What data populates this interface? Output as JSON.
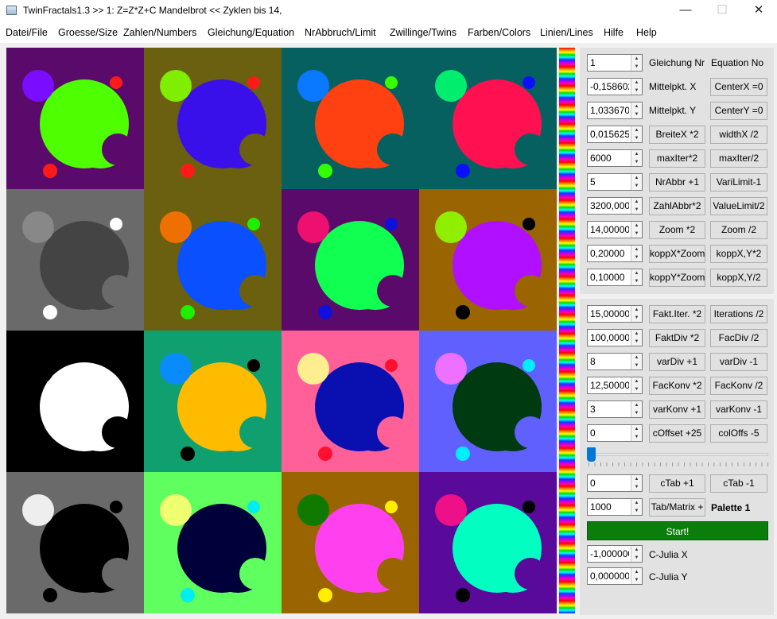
{
  "window": {
    "title": "TwinFractals1.3 >> 1: Z=Z*Z+C Mandelbrot << Zyklen bis 14,",
    "minimize": "—",
    "maximize": "☐",
    "close": "✕"
  },
  "menu": [
    "Datei/File",
    "Groesse/Size",
    "Zahlen/Numbers",
    "Gleichung/Equation",
    "NrAbbruch/Limit",
    "Zwillinge/Twins",
    "Farben/Colors",
    "Linien/Lines",
    "Hilfe",
    "Help"
  ],
  "fractal_tiles": [
    {
      "bg": "#5a0a6a",
      "body": "#4dff00",
      "big_bud": "#7a0dff",
      "small_bud": "#ff1a1a",
      "bottom_bud": "#ff1a1a"
    },
    {
      "bg": "#6b6010",
      "body": "#3a10ea",
      "big_bud": "#80ee00",
      "small_bud": "#ff1a1a",
      "bottom_bud": "#ff1a1a"
    },
    {
      "bg": "#076060",
      "body": "#ff4010",
      "big_bud": "#0a78ff",
      "small_bud": "#33ff00",
      "bottom_bud": "#33ff00"
    },
    {
      "bg": "#076060",
      "body": "#ff1050",
      "big_bud": "#00ee70",
      "small_bud": "#0a10ff",
      "bottom_bud": "#0a10ff"
    },
    {
      "bg": "#6a6a6a",
      "body": "#444444",
      "big_bud": "#888888",
      "small_bud": "#ffffff",
      "bottom_bud": "#ffffff"
    },
    {
      "bg": "#6b6010",
      "body": "#0a50ff",
      "big_bud": "#ee7000",
      "small_bud": "#20ee00",
      "bottom_bud": "#20ee00"
    },
    {
      "bg": "#5a0a6a",
      "body": "#10ff50",
      "big_bud": "#ee1070",
      "small_bud": "#1010dd",
      "bottom_bud": "#1010dd"
    },
    {
      "bg": "#9a6400",
      "body": "#b010ff",
      "big_bud": "#90ee00",
      "small_bud": "#000000",
      "bottom_bud": "#000000"
    },
    {
      "bg": "#000000",
      "body": "#ffffff",
      "big_bud": "#000000",
      "small_bud": "#000000",
      "bottom_bud": "#000000"
    },
    {
      "bg": "#10a070",
      "body": "#ffbb00",
      "big_bud": "#0a8aff",
      "small_bud": "#000000",
      "bottom_bud": "#000000"
    },
    {
      "bg": "#ff6098",
      "body": "#0a10b0",
      "big_bud": "#ffee90",
      "small_bud": "#ff1030",
      "bottom_bud": "#ff1030"
    },
    {
      "bg": "#6060ff",
      "body": "#003a10",
      "big_bud": "#ee70ff",
      "small_bud": "#00eeff",
      "bottom_bud": "#00eeff"
    },
    {
      "bg": "#6a6a6a",
      "body": "#000000",
      "big_bud": "#eeeeee",
      "small_bud": "#000000",
      "bottom_bud": "#000000"
    },
    {
      "bg": "#60ff60",
      "body": "#00003a",
      "big_bud": "#eeff70",
      "small_bud": "#00eeee",
      "bottom_bud": "#00eeee"
    },
    {
      "bg": "#9a6400",
      "body": "#ff40ee",
      "big_bud": "#107a00",
      "small_bud": "#ffee00",
      "bottom_bud": "#ffee00"
    },
    {
      "bg": "#5a0a9a",
      "body": "#00ffc0",
      "big_bud": "#ee1088",
      "small_bud": "#000000",
      "bottom_bud": "#000000"
    }
  ],
  "panel1": {
    "rows": [
      {
        "value": "1",
        "b1": "Gleichung Nr",
        "b2": "Equation No",
        "labels": true
      },
      {
        "value": "-0,158602(",
        "b1": "Mittelpkt. X",
        "b2": "CenterX =0",
        "label1": true
      },
      {
        "value": "1,0336700",
        "b1": "Mittelpkt. Y",
        "b2": "CenterY =0",
        "label1": true
      },
      {
        "value": "0,0156250",
        "b1": "BreiteX *2",
        "b2": "widthX /2"
      },
      {
        "value": "6000",
        "b1": "maxIter*2",
        "b2": "maxIter/2"
      },
      {
        "value": "5",
        "b1": "NrAbbr +1",
        "b2": "VariLimit-1"
      },
      {
        "value": "3200,0000",
        "b1": "ZahlAbbr*2",
        "b2": "ValueLimit/2"
      },
      {
        "value": "14,000000",
        "b1": "Zoom *2",
        "b2": "Zoom /2"
      },
      {
        "value": "0,20000",
        "b1": "koppX*Zoom",
        "b2": "koppX,Y*2"
      },
      {
        "value": "0,10000",
        "b1": "koppY*Zoom",
        "b2": "koppX,Y/2"
      }
    ]
  },
  "panel2": {
    "rows": [
      {
        "value": "15,00000",
        "b1": "Fakt.Iter. *2",
        "b2": "Iterations /2"
      },
      {
        "value": "100,00000",
        "b1": "FaktDiv *2",
        "b2": "FacDiv /2"
      },
      {
        "value": "8",
        "b1": "varDiv +1",
        "b2": "varDiv -1"
      },
      {
        "value": "12,50000",
        "b1": "FacKonv *2",
        "b2": "FacKonv /2"
      },
      {
        "value": "3",
        "b1": "varKonv +1",
        "b2": "varKonv -1"
      },
      {
        "value": "0",
        "b1": "cOffset +25",
        "b2": "colOffs -5"
      }
    ],
    "slider_position": 0,
    "ctab": {
      "value": "0",
      "b1": "cTab +1",
      "b2": "cTab -1"
    },
    "matrix": {
      "value": "1000",
      "b1": "Tab/Matrix +",
      "label": "Palette 1"
    },
    "start": "Start!",
    "julia_x": {
      "value": "-1,000000(",
      "label": "C-Julia X"
    },
    "julia_y": {
      "value": "0,0000000",
      "label": "C-Julia Y"
    }
  }
}
